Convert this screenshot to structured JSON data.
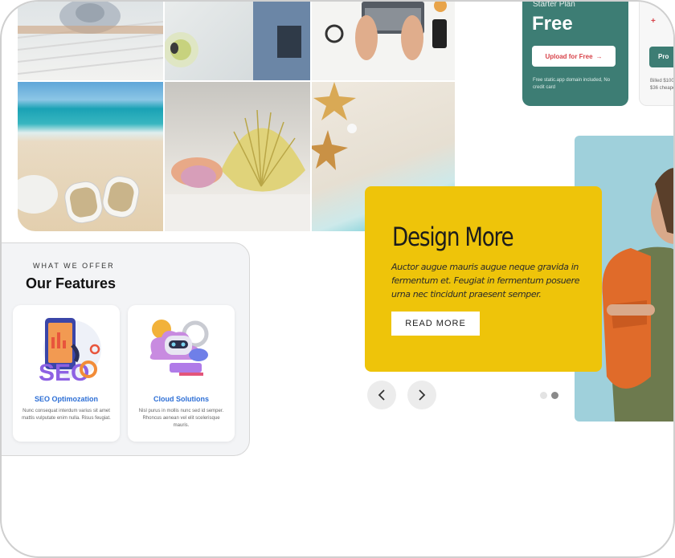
{
  "pricing": {
    "plan_name": "Starter Plan",
    "price": "Free",
    "cta_label": "Upload for Free",
    "note": "Free static.app domain included, No credit card",
    "second_cta_label": "Pro",
    "second_note_line1": "Billed $100",
    "second_note_line2": "$36 cheape"
  },
  "features": {
    "eyebrow": "WHAT WE OFFER",
    "title": "Our Features",
    "items": [
      {
        "title": "SEO Optimozation",
        "description": "Nunc consequat interdum varius sit amet mattis vulputate enim nulla. Risus feugiat."
      },
      {
        "title": "Cloud Solutions",
        "description": "Nisl purus in mollis nunc sed id semper. Rhoncus aenean vel elit scelerisque mauris."
      }
    ]
  },
  "hero": {
    "title": "Design More",
    "text": "Auctor augue mauris augue neque gravida in fermentum et. Feugiat in fermentum posuere urna nec tincidunt praesent semper.",
    "cta_label": "READ MORE"
  },
  "slider": {
    "total_slides": 2,
    "active_slide": 2
  },
  "colors": {
    "accent_teal": "#3d7d74",
    "accent_yellow": "#eec40a",
    "cta_red": "#d8434a",
    "link_blue": "#2d6fd6"
  }
}
